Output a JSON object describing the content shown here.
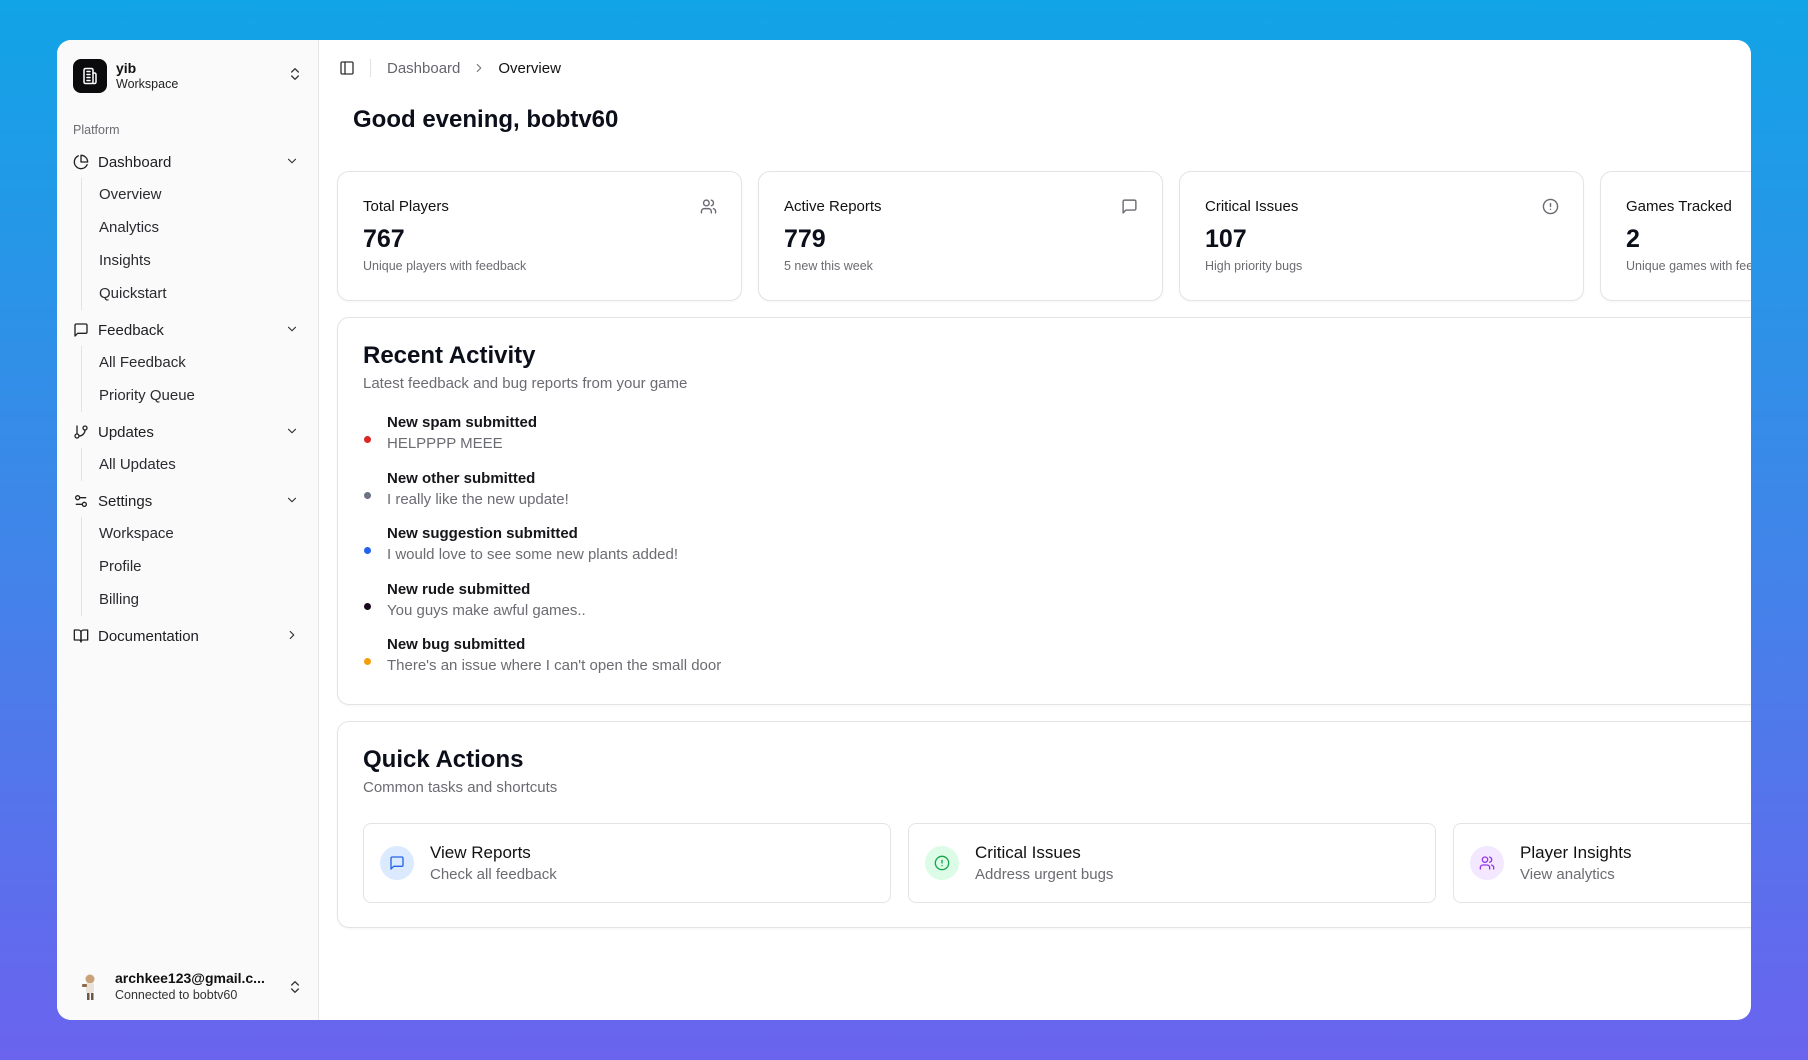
{
  "workspace": {
    "name": "yib",
    "subtitle": "Workspace"
  },
  "sidebar": {
    "section_label": "Platform",
    "groups": [
      {
        "label": "Dashboard",
        "icon": "pie-chart-icon",
        "items": [
          "Overview",
          "Analytics",
          "Insights",
          "Quickstart"
        ]
      },
      {
        "label": "Feedback",
        "icon": "message-square-icon",
        "items": [
          "All Feedback",
          "Priority Queue"
        ]
      },
      {
        "label": "Updates",
        "icon": "git-branch-icon",
        "items": [
          "All Updates"
        ]
      },
      {
        "label": "Settings",
        "icon": "sliders-icon",
        "items": [
          "Workspace",
          "Profile",
          "Billing"
        ]
      },
      {
        "label": "Documentation",
        "icon": "book-open-icon",
        "items": []
      }
    ]
  },
  "user": {
    "email": "archkee123@gmail.c...",
    "status": "Connected to bobtv60"
  },
  "breadcrumb": {
    "parent": "Dashboard",
    "current": "Overview"
  },
  "greeting": "Good evening, bobtv60",
  "stats": [
    {
      "title": "Total Players",
      "value": "767",
      "sub": "Unique players with feedback",
      "icon": "users-icon"
    },
    {
      "title": "Active Reports",
      "value": "779",
      "sub": "5 new this week",
      "icon": "message-square-icon"
    },
    {
      "title": "Critical Issues",
      "value": "107",
      "sub": "High priority bugs",
      "icon": "alert-circle-icon"
    },
    {
      "title": "Games Tracked",
      "value": "2",
      "sub": "Unique games with feedback",
      "icon": "gamepad-icon"
    }
  ],
  "activity": {
    "title": "Recent Activity",
    "subtitle": "Latest feedback and bug reports from your game",
    "items": [
      {
        "title": "New spam submitted",
        "desc": "HELPPPP MEEE",
        "color": "#dc2626"
      },
      {
        "title": "New other submitted",
        "desc": "I really like the new update!",
        "color": "#6b7280"
      },
      {
        "title": "New suggestion submitted",
        "desc": "I would love to see some new plants added!",
        "color": "#2563eb"
      },
      {
        "title": "New rude submitted",
        "desc": "You guys make awful games..",
        "color": "#1a0a1e"
      },
      {
        "title": "New bug submitted",
        "desc": "There's an issue where I can't open the small door",
        "color": "#f59e0b"
      }
    ]
  },
  "quick_actions": {
    "title": "Quick Actions",
    "subtitle": "Common tasks and shortcuts",
    "items": [
      {
        "title": "View Reports",
        "sub": "Check all feedback",
        "icon": "message-square-icon",
        "bg": "#dbeafe",
        "fg": "#2563eb"
      },
      {
        "title": "Critical Issues",
        "sub": "Address urgent bugs",
        "icon": "alert-circle-icon",
        "bg": "#dcfce7",
        "fg": "#16a34a"
      },
      {
        "title": "Player Insights",
        "sub": "View analytics",
        "icon": "users-icon",
        "bg": "#f3e8ff",
        "fg": "#9333ea"
      }
    ]
  }
}
